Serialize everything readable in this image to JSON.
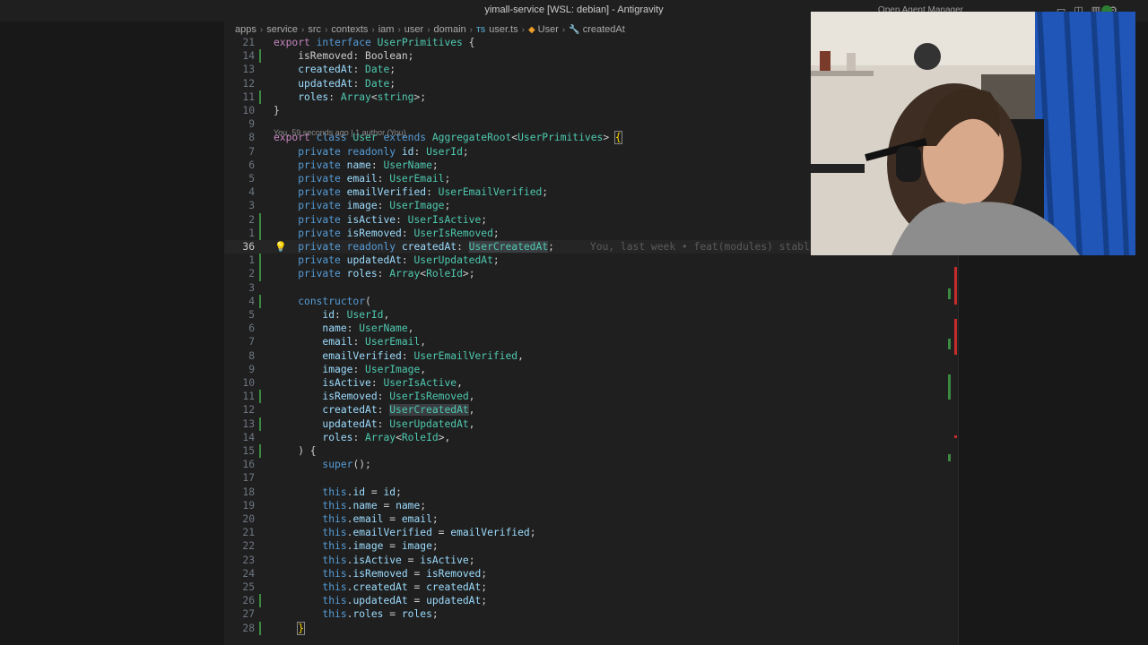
{
  "window": {
    "title": "yimall-service [WSL: debian] - Antigravity",
    "right_title": "Open Agent Manager"
  },
  "breadcrumb": [
    "apps",
    "service",
    "src",
    "contexts",
    "iam",
    "user",
    "domain",
    "user.ts",
    "User",
    "createdAt"
  ],
  "breadcrumb_icons": {
    "file": "TS",
    "class": "class-icon",
    "property": "wrench-icon"
  },
  "codelens": "You, 59 seconds ago | 1 author (You)",
  "inline_blame": "You, last week • feat(modules) stablish...",
  "lines": [
    {
      "n": "21",
      "t": [
        [
          "kw2",
          "export "
        ],
        [
          "kw",
          "interface "
        ],
        [
          "ty",
          "UserPrimitives "
        ],
        [
          "",
          "{"
        ]
      ]
    },
    {
      "n": "14",
      "t": [
        [
          "",
          "    isRemoved: Boolean;"
        ]
      ]
    },
    {
      "n": "13",
      "t": [
        [
          "",
          "    "
        ],
        [
          "pr",
          "createdAt"
        ],
        [
          "",
          ": "
        ],
        [
          "ty",
          "Date"
        ],
        [
          "",
          ";"
        ]
      ]
    },
    {
      "n": "12",
      "t": [
        [
          "",
          "    "
        ],
        [
          "pr",
          "updatedAt"
        ],
        [
          "",
          ": "
        ],
        [
          "ty",
          "Date"
        ],
        [
          "",
          ";"
        ]
      ]
    },
    {
      "n": "11",
      "t": [
        [
          "",
          "    "
        ],
        [
          "pr",
          "roles"
        ],
        [
          "",
          ": "
        ],
        [
          "ty",
          "Array"
        ],
        [
          "",
          "<"
        ],
        [
          "ty",
          "string"
        ],
        [
          "",
          ">;"
        ]
      ]
    },
    {
      "n": "10",
      "t": [
        [
          "",
          "}"
        ]
      ]
    },
    {
      "n": "9",
      "t": []
    },
    {
      "n": "8",
      "t": [
        [
          "kw2",
          "export "
        ],
        [
          "kw",
          "class "
        ],
        [
          "ty",
          "User "
        ],
        [
          "kw",
          "extends "
        ],
        [
          "ty",
          "AggregateRoot"
        ],
        [
          "",
          "<"
        ],
        [
          "ty",
          "UserPrimitives"
        ],
        [
          "",
          "> "
        ],
        [
          "brk",
          "{"
        ]
      ]
    },
    {
      "n": "7",
      "t": [
        [
          "",
          "    "
        ],
        [
          "kw",
          "private readonly "
        ],
        [
          "pr",
          "id"
        ],
        [
          "",
          ": "
        ],
        [
          "ty",
          "UserId"
        ],
        [
          "",
          ";"
        ]
      ]
    },
    {
      "n": "6",
      "t": [
        [
          "",
          "    "
        ],
        [
          "kw",
          "private "
        ],
        [
          "pr",
          "name"
        ],
        [
          "",
          ": "
        ],
        [
          "ty",
          "UserName"
        ],
        [
          "",
          ";"
        ]
      ]
    },
    {
      "n": "5",
      "t": [
        [
          "",
          "    "
        ],
        [
          "kw",
          "private "
        ],
        [
          "pr",
          "email"
        ],
        [
          "",
          ": "
        ],
        [
          "ty",
          "UserEmail"
        ],
        [
          "",
          ";"
        ]
      ]
    },
    {
      "n": "4",
      "t": [
        [
          "",
          "    "
        ],
        [
          "kw",
          "private "
        ],
        [
          "pr",
          "emailVerified"
        ],
        [
          "",
          ": "
        ],
        [
          "ty",
          "UserEmailVerified"
        ],
        [
          "",
          ";"
        ]
      ]
    },
    {
      "n": "3",
      "t": [
        [
          "",
          "    "
        ],
        [
          "kw",
          "private "
        ],
        [
          "pr",
          "image"
        ],
        [
          "",
          ": "
        ],
        [
          "ty",
          "UserImage"
        ],
        [
          "",
          ";"
        ]
      ]
    },
    {
      "n": "2",
      "t": [
        [
          "",
          "    "
        ],
        [
          "kw",
          "private "
        ],
        [
          "pr",
          "isActive"
        ],
        [
          "",
          ": "
        ],
        [
          "ty",
          "UserIsActive"
        ],
        [
          "",
          ";"
        ]
      ]
    },
    {
      "n": "1",
      "t": [
        [
          "",
          "    "
        ],
        [
          "kw",
          "private "
        ],
        [
          "pr",
          "isRemoved"
        ],
        [
          "",
          ": "
        ],
        [
          "ty",
          "UserIsRemoved"
        ],
        [
          "",
          ";"
        ]
      ]
    },
    {
      "n": "36",
      "t": [
        [
          "",
          "    "
        ],
        [
          "kw",
          "private readonly "
        ],
        [
          "pr",
          "createdAt"
        ],
        [
          "",
          ": "
        ],
        [
          "ty hl",
          "UserCreatedAt"
        ],
        [
          "",
          ";"
        ]
      ]
    },
    {
      "n": "1",
      "t": [
        [
          "",
          "    "
        ],
        [
          "kw",
          "private "
        ],
        [
          "pr",
          "updatedAt"
        ],
        [
          "",
          ": "
        ],
        [
          "ty",
          "UserUpdatedAt"
        ],
        [
          "",
          ";"
        ]
      ]
    },
    {
      "n": "2",
      "t": [
        [
          "",
          "    "
        ],
        [
          "kw",
          "private "
        ],
        [
          "pr",
          "roles"
        ],
        [
          "",
          ": "
        ],
        [
          "ty",
          "Array"
        ],
        [
          "",
          "<"
        ],
        [
          "ty",
          "RoleId"
        ],
        [
          "",
          ">;"
        ]
      ]
    },
    {
      "n": "3",
      "t": []
    },
    {
      "n": "4",
      "t": [
        [
          "",
          "    "
        ],
        [
          "kw",
          "constructor"
        ],
        [
          "",
          "("
        ]
      ]
    },
    {
      "n": "5",
      "t": [
        [
          "",
          "        "
        ],
        [
          "pr",
          "id"
        ],
        [
          "",
          ": "
        ],
        [
          "ty",
          "UserId"
        ],
        [
          "",
          ","
        ]
      ]
    },
    {
      "n": "6",
      "t": [
        [
          "",
          "        "
        ],
        [
          "pr",
          "name"
        ],
        [
          "",
          ": "
        ],
        [
          "ty",
          "UserName"
        ],
        [
          "",
          ","
        ]
      ]
    },
    {
      "n": "7",
      "t": [
        [
          "",
          "        "
        ],
        [
          "pr",
          "email"
        ],
        [
          "",
          ": "
        ],
        [
          "ty",
          "UserEmail"
        ],
        [
          "",
          ","
        ]
      ]
    },
    {
      "n": "8",
      "t": [
        [
          "",
          "        "
        ],
        [
          "pr",
          "emailVerified"
        ],
        [
          "",
          ": "
        ],
        [
          "ty",
          "UserEmailVerified"
        ],
        [
          "",
          ","
        ]
      ]
    },
    {
      "n": "9",
      "t": [
        [
          "",
          "        "
        ],
        [
          "pr",
          "image"
        ],
        [
          "",
          ": "
        ],
        [
          "ty",
          "UserImage"
        ],
        [
          "",
          ","
        ]
      ]
    },
    {
      "n": "10",
      "t": [
        [
          "",
          "        "
        ],
        [
          "pr",
          "isActive"
        ],
        [
          "",
          ": "
        ],
        [
          "ty",
          "UserIsActive"
        ],
        [
          "",
          ","
        ]
      ]
    },
    {
      "n": "11",
      "t": [
        [
          "",
          "        "
        ],
        [
          "pr",
          "isRemoved"
        ],
        [
          "",
          ": "
        ],
        [
          "ty",
          "UserIsRemoved"
        ],
        [
          "",
          ","
        ]
      ]
    },
    {
      "n": "12",
      "t": [
        [
          "",
          "        "
        ],
        [
          "pr",
          "createdAt"
        ],
        [
          "",
          ": "
        ],
        [
          "ty hl",
          "UserCreatedAt"
        ],
        [
          "",
          ","
        ]
      ]
    },
    {
      "n": "13",
      "t": [
        [
          "",
          "        "
        ],
        [
          "pr",
          "updatedAt"
        ],
        [
          "",
          ": "
        ],
        [
          "ty",
          "UserUpdatedAt"
        ],
        [
          "",
          ","
        ]
      ]
    },
    {
      "n": "14",
      "t": [
        [
          "",
          "        "
        ],
        [
          "pr",
          "roles"
        ],
        [
          "",
          ": "
        ],
        [
          "ty",
          "Array"
        ],
        [
          "",
          "<"
        ],
        [
          "ty",
          "RoleId"
        ],
        [
          "",
          ">,"
        ]
      ]
    },
    {
      "n": "15",
      "t": [
        [
          "",
          "    ) {"
        ]
      ]
    },
    {
      "n": "16",
      "t": [
        [
          "",
          "        "
        ],
        [
          "kw",
          "super"
        ],
        [
          "",
          "();"
        ]
      ]
    },
    {
      "n": "17",
      "t": []
    },
    {
      "n": "18",
      "t": [
        [
          "",
          "        "
        ],
        [
          "kw",
          "this"
        ],
        [
          "",
          "."
        ],
        [
          "pr",
          "id"
        ],
        [
          "",
          " = "
        ],
        [
          "pr",
          "id"
        ],
        [
          "",
          ";"
        ]
      ]
    },
    {
      "n": "19",
      "t": [
        [
          "",
          "        "
        ],
        [
          "kw",
          "this"
        ],
        [
          "",
          "."
        ],
        [
          "pr",
          "name"
        ],
        [
          "",
          " = "
        ],
        [
          "pr",
          "name"
        ],
        [
          "",
          ";"
        ]
      ]
    },
    {
      "n": "20",
      "t": [
        [
          "",
          "        "
        ],
        [
          "kw",
          "this"
        ],
        [
          "",
          "."
        ],
        [
          "pr",
          "email"
        ],
        [
          "",
          " = "
        ],
        [
          "pr",
          "email"
        ],
        [
          "",
          ";"
        ]
      ]
    },
    {
      "n": "21",
      "t": [
        [
          "",
          "        "
        ],
        [
          "kw",
          "this"
        ],
        [
          "",
          "."
        ],
        [
          "pr",
          "emailVerified"
        ],
        [
          "",
          " = "
        ],
        [
          "pr",
          "emailVerified"
        ],
        [
          "",
          ";"
        ]
      ]
    },
    {
      "n": "22",
      "t": [
        [
          "",
          "        "
        ],
        [
          "kw",
          "this"
        ],
        [
          "",
          "."
        ],
        [
          "pr",
          "image"
        ],
        [
          "",
          " = "
        ],
        [
          "pr",
          "image"
        ],
        [
          "",
          ";"
        ]
      ]
    },
    {
      "n": "23",
      "t": [
        [
          "",
          "        "
        ],
        [
          "kw",
          "this"
        ],
        [
          "",
          "."
        ],
        [
          "pr",
          "isActive"
        ],
        [
          "",
          " = "
        ],
        [
          "pr",
          "isActive"
        ],
        [
          "",
          ";"
        ]
      ]
    },
    {
      "n": "24",
      "t": [
        [
          "",
          "        "
        ],
        [
          "kw",
          "this"
        ],
        [
          "",
          "."
        ],
        [
          "pr",
          "isRemoved"
        ],
        [
          "",
          " = "
        ],
        [
          "pr",
          "isRemoved"
        ],
        [
          "",
          ";"
        ]
      ]
    },
    {
      "n": "25",
      "t": [
        [
          "",
          "        "
        ],
        [
          "kw",
          "this"
        ],
        [
          "",
          "."
        ],
        [
          "pr",
          "createdAt"
        ],
        [
          "",
          " = "
        ],
        [
          "pr",
          "createdAt"
        ],
        [
          "",
          ";"
        ]
      ]
    },
    {
      "n": "26",
      "t": [
        [
          "",
          "        "
        ],
        [
          "kw",
          "this"
        ],
        [
          "",
          "."
        ],
        [
          "pr",
          "updatedAt"
        ],
        [
          "",
          " = "
        ],
        [
          "pr",
          "updatedAt"
        ],
        [
          "",
          ";"
        ]
      ]
    },
    {
      "n": "27",
      "t": [
        [
          "",
          "        "
        ],
        [
          "kw",
          "this"
        ],
        [
          "",
          "."
        ],
        [
          "pr",
          "roles"
        ],
        [
          "",
          " = "
        ],
        [
          "pr",
          "roles"
        ],
        [
          "",
          ";"
        ]
      ]
    },
    {
      "n": "28",
      "t": [
        [
          "",
          "    "
        ],
        [
          "brk",
          "}"
        ]
      ]
    }
  ],
  "modified_line_numbers": [
    "11",
    "8",
    "2",
    "1",
    "1",
    "2",
    "4",
    "9",
    "11",
    "13",
    "23",
    "27"
  ],
  "current_line_number": "36",
  "colors": {
    "editor_bg": "#1f1f1f",
    "keyword": "#569cd6",
    "control_keyword": "#c586c0",
    "type": "#4ec9b0",
    "property": "#9cdcfe",
    "git_added": "#3c8a40",
    "git_deleted": "#c42b2b"
  },
  "webcam_overlay": {
    "icons": [
      "circle-button-icon"
    ]
  }
}
